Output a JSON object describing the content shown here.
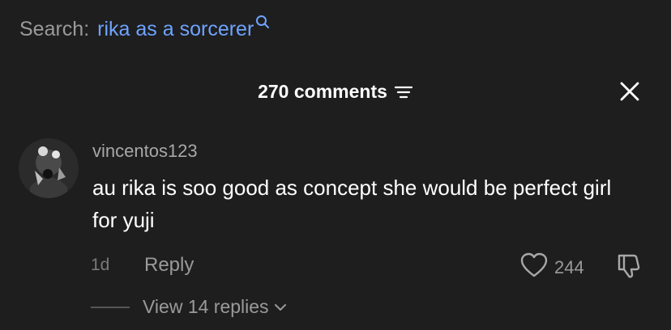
{
  "search": {
    "prefix": "Search:",
    "query": "rika as a sorcerer"
  },
  "header": {
    "comments_count_label": "270 comments"
  },
  "comment": {
    "username": "vincentos123",
    "text": "au rika is soo good as concept she would be perfect girl for yuji",
    "timestamp": "1d",
    "reply_label": "Reply",
    "like_count": "244",
    "view_replies_label": "View 14 replies"
  },
  "icons": {
    "search": "search-icon",
    "filter": "filter-icon",
    "close": "close-icon",
    "like": "heart-icon",
    "dislike": "thumbs-down-icon",
    "chevron": "chevron-down-icon"
  },
  "colors": {
    "background": "#1e1e1e",
    "query": "#6ea3ff",
    "muted": "#9a9a9a"
  }
}
